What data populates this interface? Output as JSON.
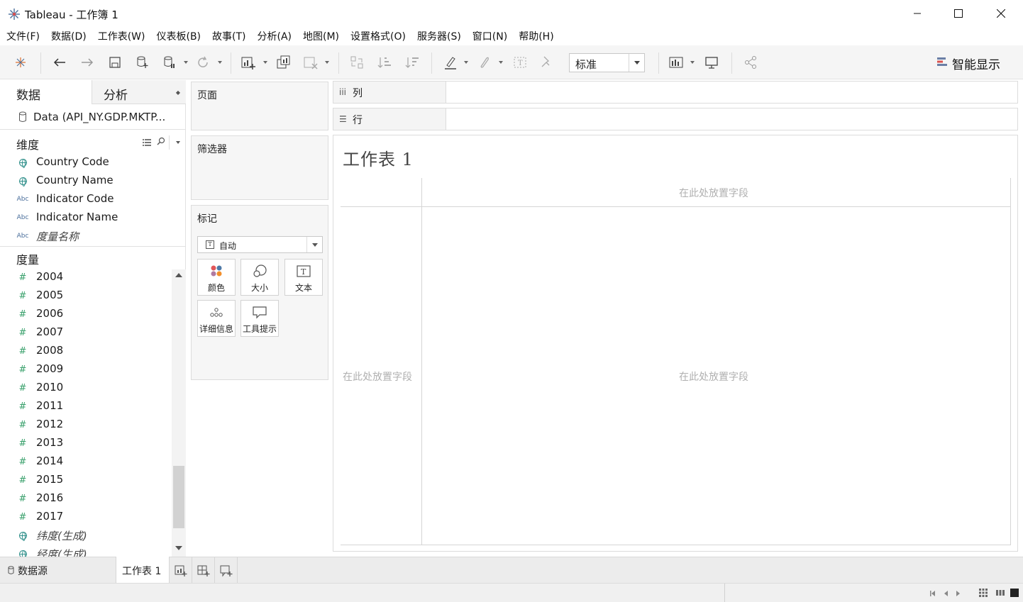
{
  "window": {
    "title": "Tableau - 工作簿 1"
  },
  "menu": [
    "文件(F)",
    "数据(D)",
    "工作表(W)",
    "仪表板(B)",
    "故事(T)",
    "分析(A)",
    "地图(M)",
    "设置格式(O)",
    "服务器(S)",
    "窗口(N)",
    "帮助(H)"
  ],
  "toolbar": {
    "fit_value": "标准",
    "show_me_label": "智能显示"
  },
  "left_pane": {
    "tab_data": "数据",
    "tab_analysis": "分析",
    "datasource": "Data (API_NY.GDP.MKTP...",
    "dimensions_title": "维度",
    "dimensions": [
      {
        "type": "geo",
        "name": "Country Code"
      },
      {
        "type": "geo",
        "name": "Country Name"
      },
      {
        "type": "abc",
        "name": "Indicator Code"
      },
      {
        "type": "abc",
        "name": "Indicator Name"
      },
      {
        "type": "abc",
        "name": "度量名称"
      }
    ],
    "measures_title": "度量",
    "measures": [
      {
        "type": "num",
        "name": "2004"
      },
      {
        "type": "num",
        "name": "2005"
      },
      {
        "type": "num",
        "name": "2006"
      },
      {
        "type": "num",
        "name": "2007"
      },
      {
        "type": "num",
        "name": "2008"
      },
      {
        "type": "num",
        "name": "2009"
      },
      {
        "type": "num",
        "name": "2010"
      },
      {
        "type": "num",
        "name": "2011"
      },
      {
        "type": "num",
        "name": "2012"
      },
      {
        "type": "num",
        "name": "2013"
      },
      {
        "type": "num",
        "name": "2014"
      },
      {
        "type": "num",
        "name": "2015"
      },
      {
        "type": "num",
        "name": "2016"
      },
      {
        "type": "num",
        "name": "2017"
      },
      {
        "type": "geo",
        "name": "纬度(生成)"
      },
      {
        "type": "geo",
        "name": "经度(生成)"
      }
    ],
    "abc_icon_text": "Abc"
  },
  "cards": {
    "pages": "页面",
    "filters": "筛选器",
    "marks": "标记",
    "marks_type": "自动",
    "marks_type_icon": "T",
    "mark_buttons": [
      "颜色",
      "大小",
      "文本",
      "详细信息",
      "工具提示"
    ],
    "text_icon": "T"
  },
  "shelves": {
    "columns": "列",
    "rows": "行",
    "columns_icon": "iii",
    "rows_icon": "☰"
  },
  "view": {
    "sheet_title": "工作表 1",
    "drop_top": "在此处放置字段",
    "drop_left": "在此处放置字段",
    "drop_center": "在此处放置字段"
  },
  "bottom_tabs": {
    "datasource": "数据源",
    "sheet1": "工作表 1"
  },
  "colors": {
    "accent_teal": "#2f8f8a",
    "measure_green": "#38a06b",
    "dimension_blue": "#4a6e9b"
  }
}
